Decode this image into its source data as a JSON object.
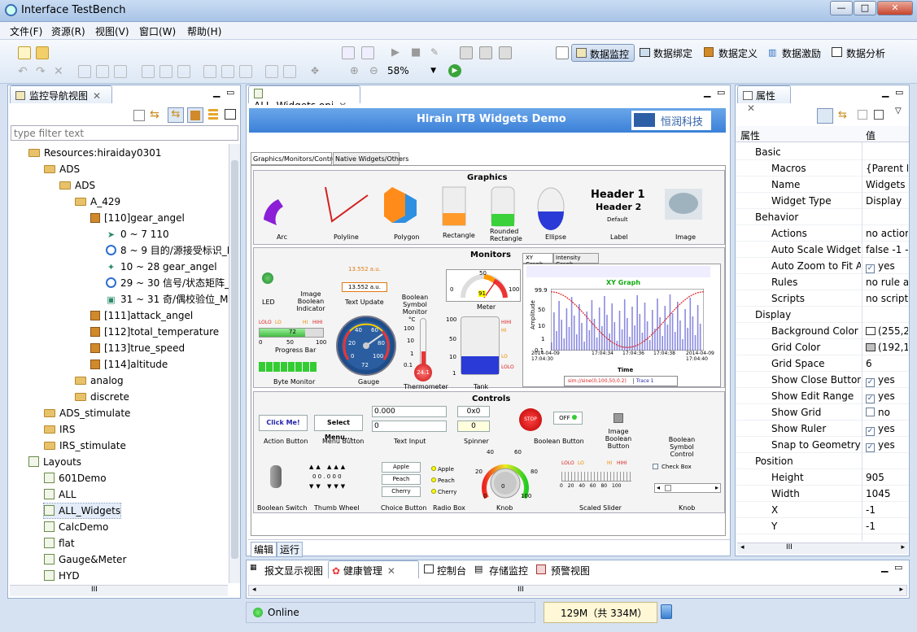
{
  "window": {
    "title": "Interface TestBench",
    "min": "—",
    "max": "□",
    "close": "✕"
  },
  "menu": [
    "文件(F)",
    "资源(R)",
    "视图(V)",
    "窗口(W)",
    "帮助(H)"
  ],
  "toolbar": {
    "zoom": "58%",
    "perspectives": [
      "数据监控",
      "数据绑定",
      "数据定义",
      "数据激励",
      "数据分析"
    ]
  },
  "nav": {
    "title": "监控导航视图",
    "filter_placeholder": "type filter text",
    "tree": [
      {
        "label": "Resources:hiraiday0301",
        "icon": "folder-open-icon",
        "level": 1
      },
      {
        "label": "ADS",
        "icon": "folder-icon",
        "level": 2
      },
      {
        "label": "ADS",
        "icon": "folder-icon",
        "level": 3
      },
      {
        "label": "A_429",
        "icon": "folder-icon",
        "level": 4
      },
      {
        "label": "[110]gear_angel",
        "icon": "cube-icon",
        "level": 5
      },
      {
        "label": "0 ~ 7 110",
        "icon": "label-icon",
        "level": 6
      },
      {
        "label": "8 ~ 9 目的/源接受标识_N",
        "icon": "e-icon",
        "level": 6
      },
      {
        "label": "10 ~ 28 gear_angel",
        "icon": "star-icon",
        "level": 6
      },
      {
        "label": "29 ~ 30 信号/状态矩阵_l",
        "icon": "e-icon",
        "level": 6
      },
      {
        "label": "31 ~ 31 奇/偶校验位_M",
        "icon": "bit-icon",
        "level": 6
      },
      {
        "label": "[111]attack_angel",
        "icon": "cube-icon",
        "level": 5
      },
      {
        "label": "[112]total_temperature",
        "icon": "cube-icon",
        "level": 5
      },
      {
        "label": "[113]true_speed",
        "icon": "cube-icon",
        "level": 5
      },
      {
        "label": "[114]altitude",
        "icon": "cube-icon",
        "level": 5
      },
      {
        "label": "analog",
        "icon": "folder-icon",
        "level": 4
      },
      {
        "label": "discrete",
        "icon": "folder-icon",
        "level": 4
      },
      {
        "label": "ADS_stimulate",
        "icon": "folder-icon",
        "level": 2
      },
      {
        "label": "IRS",
        "icon": "folder-icon",
        "level": 2
      },
      {
        "label": "IRS_stimulate",
        "icon": "folder-icon",
        "level": 2
      },
      {
        "label": "Layouts",
        "icon": "layouts-icon",
        "level": 1
      },
      {
        "label": "601Demo",
        "icon": "page-icon",
        "level": 2
      },
      {
        "label": "ALL",
        "icon": "page-icon",
        "level": 2
      },
      {
        "label": "ALL_Widgets",
        "icon": "page-icon",
        "level": 2
      },
      {
        "label": "CalcDemo",
        "icon": "page-icon",
        "level": 2
      },
      {
        "label": "flat",
        "icon": "page-icon",
        "level": 2
      },
      {
        "label": "Gauge&Meter",
        "icon": "page-icon",
        "level": 2
      },
      {
        "label": "HYD",
        "icon": "page-icon",
        "level": 2
      }
    ],
    "scroll_label": "III"
  },
  "editor": {
    "tab": "ALL_Widgets.opi",
    "banner": "Hirain ITB Widgets Demo",
    "logo": "恒润科技",
    "subtabs": [
      "Graphics/Monitors/Controls",
      "Native Widgets/Others"
    ],
    "bottom_tabs": [
      "编辑",
      "运行"
    ],
    "graphics": {
      "title": "Graphics",
      "labels": [
        "Arc",
        "Polyline",
        "Polygon",
        "Rectangle",
        "Rounded Rectangle",
        "Ellipse",
        "Label",
        "Image"
      ],
      "header1": "Header 1",
      "header2": "Header 2",
      "default": "Default"
    },
    "monitors": {
      "title": "Monitors",
      "led": "LED",
      "image_bool": "Image Boolean Indicator",
      "text_update": "Text Update",
      "text_val": "13.552 a.u.",
      "bool_sym": "Boolean Symbol Monitor",
      "meter": "Meter",
      "meter_val": "91",
      "progress": "Progress Bar",
      "progress_val": "72",
      "byte": "Byte Monitor",
      "gauge": "Gauge",
      "gauge_val": "72",
      "thermo": "Thermometer",
      "thermo_val": "24.1",
      "tank": "Tank",
      "limit_marks": [
        "LOLO",
        "LO",
        "HI",
        "HIHI"
      ],
      "meter_ticks": [
        "0",
        "50",
        "100"
      ],
      "progress_ticks": [
        "0",
        "50",
        "100"
      ],
      "gauge_ticks": [
        "0",
        "20",
        "40",
        "60",
        "80",
        "100"
      ],
      "thermo_ticks": [
        "°C",
        "100",
        "10",
        "1",
        "0.1"
      ],
      "tank_ticks": [
        "100",
        "50",
        "10",
        "1"
      ],
      "xy": {
        "tabs": [
          "XY Graph",
          "Intensity Graph"
        ],
        "title": "XY Graph",
        "ylabel": "Amplitude",
        "xlabel": "Time",
        "y_ticks": [
          "99.9",
          "50",
          "10",
          "1",
          "0.1"
        ],
        "x_ticks": [
          "2014-04-09\n17:04:30",
          "17:04:34",
          "17:04:36",
          "17:04:38",
          "2014-04-09\n17:04:40"
        ],
        "legend": "sim://sine(0,100,50,0.2)",
        "legend2": "Trace 1"
      }
    },
    "controls": {
      "title": "Controls",
      "action": "Click Me!",
      "action_lbl": "Action Button",
      "menu": "Select Menu...",
      "menu_lbl": "Menu Button",
      "text1": "0.000",
      "text2": "0",
      "text_lbl": "Text Input",
      "spin1": "0x0",
      "spin2": "0",
      "spin_lbl": "Spinner",
      "stop": "STOP",
      "off": "OFF",
      "bool_lbl": "Boolean Button",
      "img_bool_lbl": "Image Boolean Button",
      "bool_sym_lbl": "Boolean Symbol Control",
      "switch_lbl": "Boolean Switch",
      "thumb": "0 0 . 0 0 0",
      "thumb_lbl": "Thumb Wheel",
      "choices": [
        "Apple",
        "Peach",
        "Cherry"
      ],
      "choice_lbl": "Choice Button",
      "radio_lbl": "Radio Box",
      "knob_lbl": "Knob",
      "knob_val": "0",
      "slider_lbl": "Scaled Slider",
      "checkbox": "Check Box",
      "knob2_lbl": "Knob",
      "knob_ticks": [
        "0",
        "20",
        "40",
        "60",
        "80",
        "100"
      ],
      "slider_ticks": [
        "0",
        "20",
        "40",
        "60",
        "80",
        "100"
      ]
    }
  },
  "props": {
    "title": "属性",
    "col1": "属性",
    "col2": "值",
    "rows": [
      {
        "k": "Basic",
        "v": "",
        "group": true
      },
      {
        "k": "Macros",
        "v": "{Parent M"
      },
      {
        "k": "Name",
        "v": "Widgets"
      },
      {
        "k": "Widget Type",
        "v": "Display"
      },
      {
        "k": "Behavior",
        "v": "",
        "group": true
      },
      {
        "k": "Actions",
        "v": "no actior"
      },
      {
        "k": "Auto Scale Widgets",
        "v": "false -1 -"
      },
      {
        "k": "Auto Zoom to Fit A",
        "v": "yes",
        "chk": true
      },
      {
        "k": "Rules",
        "v": "no rule a"
      },
      {
        "k": "Scripts",
        "v": "no script"
      },
      {
        "k": "Display",
        "v": "",
        "group": true
      },
      {
        "k": "Background Color",
        "v": "(255,2",
        "sw": "#ffffff"
      },
      {
        "k": "Grid Color",
        "v": "(192,1",
        "sw": "#c0c0c0"
      },
      {
        "k": "Grid Space",
        "v": "6"
      },
      {
        "k": "Show Close Button",
        "v": "yes",
        "chk": true
      },
      {
        "k": "Show Edit Range",
        "v": "yes",
        "chk": true
      },
      {
        "k": "Show Grid",
        "v": "no",
        "chk": false
      },
      {
        "k": "Show Ruler",
        "v": "yes",
        "chk": true
      },
      {
        "k": "Snap to Geometry",
        "v": "yes",
        "chk": true
      },
      {
        "k": "Position",
        "v": "",
        "group": true
      },
      {
        "k": "Height",
        "v": "905"
      },
      {
        "k": "Width",
        "v": "1045"
      },
      {
        "k": "X",
        "v": "-1"
      },
      {
        "k": "Y",
        "v": "-1"
      }
    ],
    "scroll_label": "III"
  },
  "bottom": {
    "tabs": [
      "报文显示视图",
      "健康管理",
      "控制台",
      "存储监控",
      "预警视图"
    ],
    "scroll_label": "III"
  },
  "status": {
    "online": "Online",
    "memory": "129M（共 334M）"
  }
}
